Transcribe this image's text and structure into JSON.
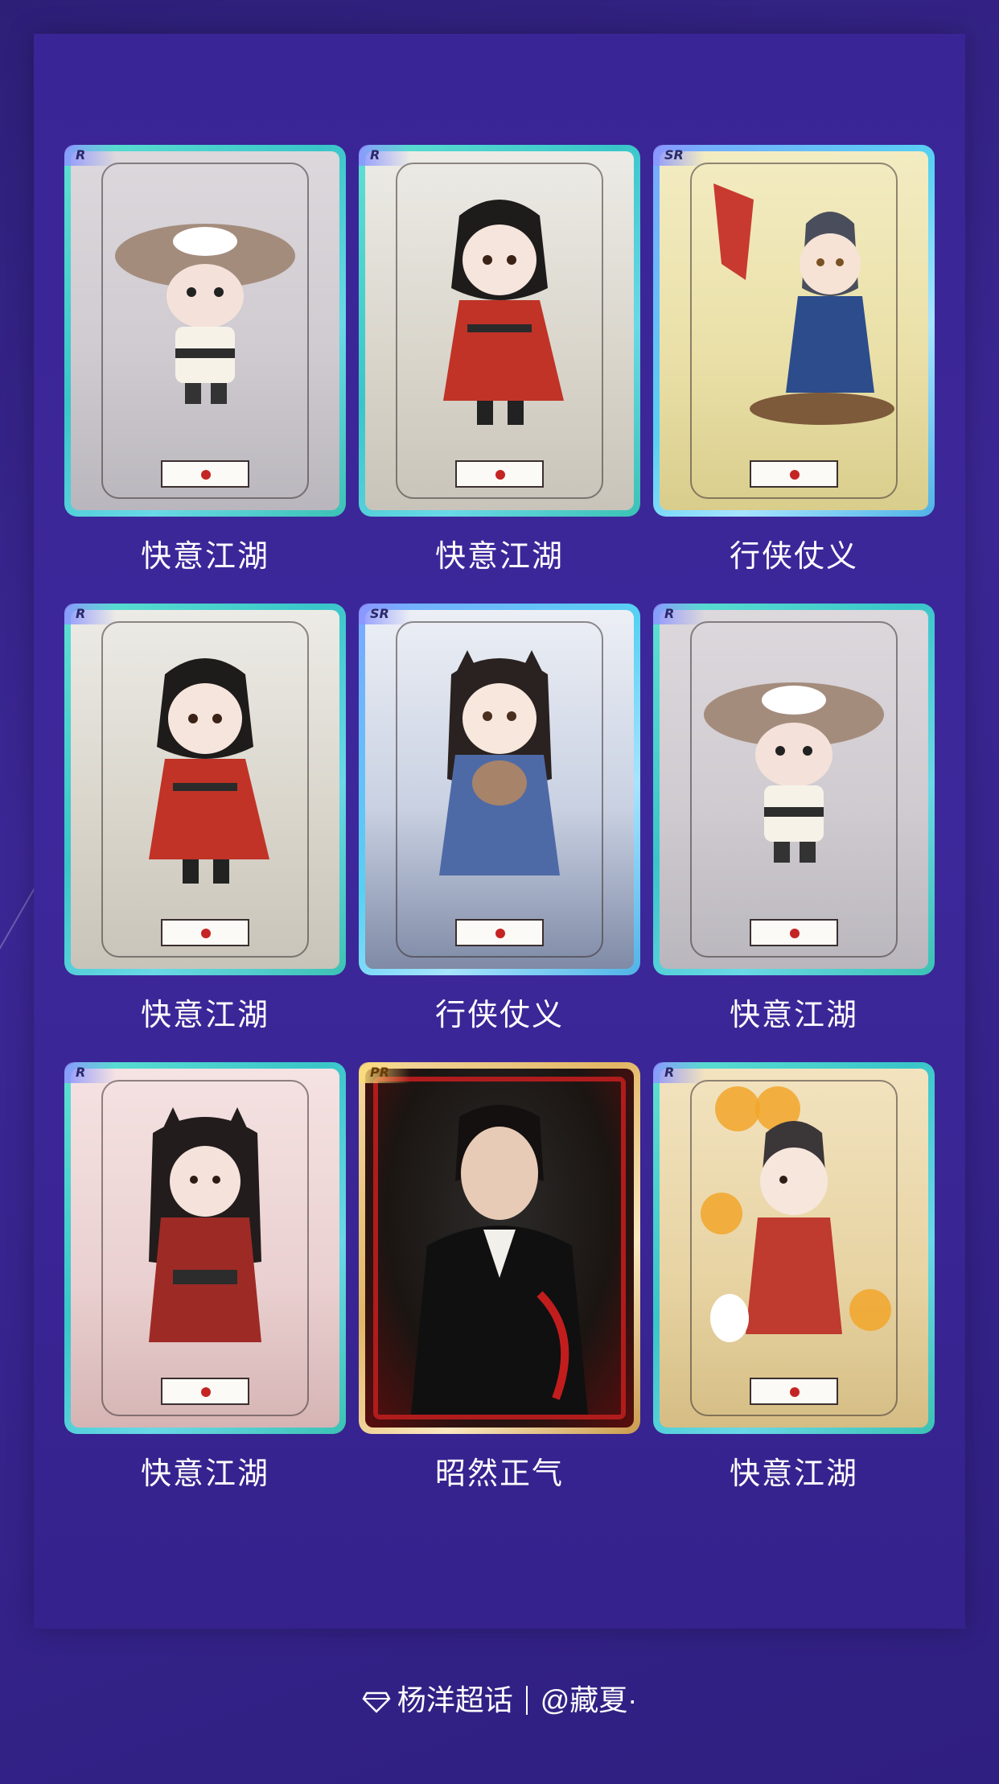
{
  "cards": [
    {
      "rarity": "R",
      "title": "快意江湖"
    },
    {
      "rarity": "R",
      "title": "快意江湖"
    },
    {
      "rarity": "SR",
      "title": "行侠仗义"
    },
    {
      "rarity": "R",
      "title": "快意江湖"
    },
    {
      "rarity": "SR",
      "title": "行侠仗义"
    },
    {
      "rarity": "R",
      "title": "快意江湖"
    },
    {
      "rarity": "R",
      "title": "快意江湖"
    },
    {
      "rarity": "PR",
      "title": "昭然正气"
    },
    {
      "rarity": "R",
      "title": "快意江湖"
    }
  ],
  "footer": {
    "icon": "diamond-icon",
    "community": "杨洋超话",
    "author": "@藏夏·"
  }
}
